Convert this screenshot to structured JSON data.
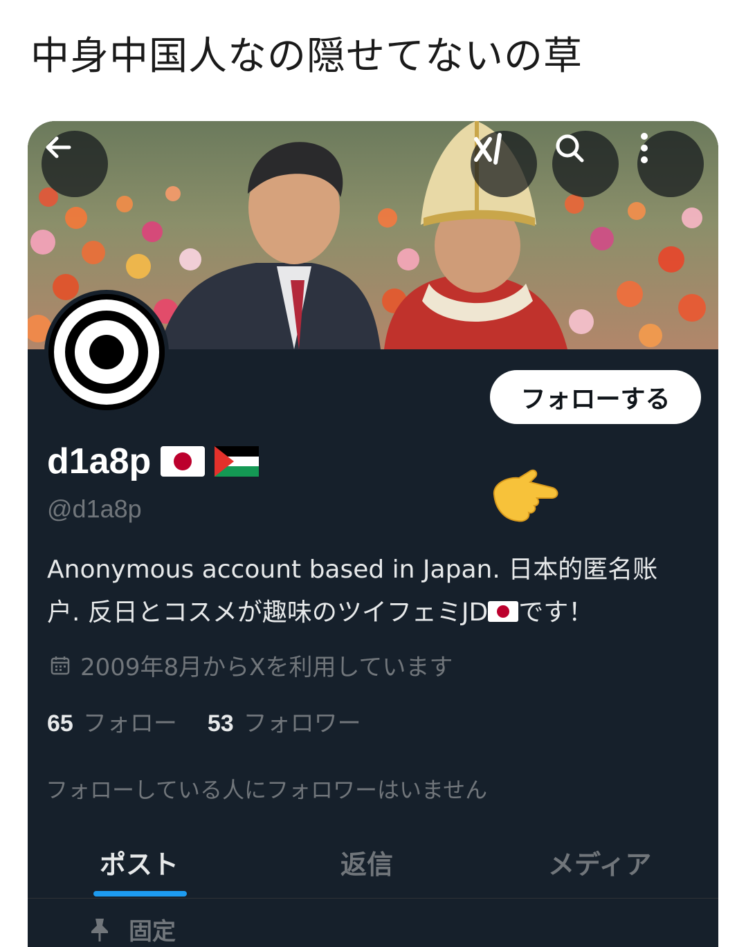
{
  "post": {
    "text": "中身中国人なの隠せてないの草"
  },
  "profile": {
    "display_name": "d1a8p",
    "handle": "@d1a8p",
    "follow_label": "フォローする",
    "bio_line1": "Anonymous account based in Japan. 日本的匿名账",
    "bio_line2a": "户. 反日とコスメが趣味のツイフェミJD",
    "bio_line2b": "です！",
    "joined": "2009年8月からXを利用しています",
    "following_count": "65",
    "following_label": "フォロー",
    "followers_count": "53",
    "followers_label": "フォロワー",
    "no_mutuals": "フォローしている人にフォロワーはいません",
    "name_flags": [
      "japan-flag-icon",
      "palestine-flag-icon"
    ]
  },
  "header": {
    "icons": [
      "back-arrow-icon",
      "grok-icon",
      "search-icon",
      "more-vertical-icon"
    ]
  },
  "tabs": {
    "posts": "ポスト",
    "replies": "返信",
    "media": "メディア",
    "active": "posts"
  },
  "pinned": {
    "label": "固定",
    "icon": "pin-icon"
  },
  "colors": {
    "background": "#16202b",
    "accent": "#1d9bf0",
    "muted_text": "#71767b",
    "primary_text": "#e7e9ea"
  }
}
